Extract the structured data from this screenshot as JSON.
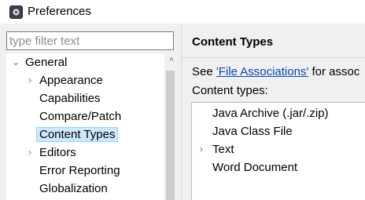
{
  "window": {
    "title": "Preferences",
    "icon": "preferences-app-icon"
  },
  "filter": {
    "placeholder": "type filter text",
    "value": ""
  },
  "tree": {
    "root": {
      "label": "General",
      "expanded": true
    },
    "items": [
      {
        "label": "Appearance",
        "expandable": true
      },
      {
        "label": "Capabilities",
        "expandable": false
      },
      {
        "label": "Compare/Patch",
        "expandable": false
      },
      {
        "label": "Content Types",
        "expandable": false,
        "selected": true
      },
      {
        "label": "Editors",
        "expandable": true
      },
      {
        "label": "Error Reporting",
        "expandable": false
      },
      {
        "label": "Globalization",
        "expandable": false
      }
    ]
  },
  "page": {
    "title": "Content Types",
    "see_prefix": "See ",
    "link_text": "'File Associations'",
    "see_suffix": " for assoc",
    "types_label": "Content types:",
    "content_types": [
      {
        "label": "Java Archive (.jar/.zip)",
        "expandable": false
      },
      {
        "label": "Java Class File",
        "expandable": false
      },
      {
        "label": "Text",
        "expandable": true
      },
      {
        "label": "Word Document",
        "expandable": false
      }
    ]
  },
  "glyphs": {
    "collapsed": "›",
    "expanded": "⌄",
    "scroll_up": "^"
  },
  "colors": {
    "selection_bg": "#cce8ff",
    "selection_border": "#99d1ff",
    "link": "#0645ad",
    "panel_bg": "#f0f0f0"
  }
}
